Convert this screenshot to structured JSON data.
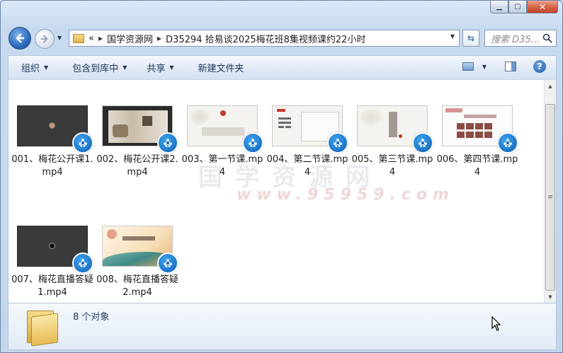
{
  "window": {
    "caption_minimize": "0",
    "caption_maximize": "1",
    "caption_close": "×"
  },
  "address_bar": {
    "chevron": "«",
    "breadcrumbs": [
      "国学资源网",
      "D35294 拾易谈2025梅花班8集视频课约22小时"
    ]
  },
  "search": {
    "placeholder": "搜索 D35..."
  },
  "toolbar": {
    "organize": "组织",
    "include_library": "包含到库中",
    "share": "共享",
    "new_folder": "新建文件夹"
  },
  "watermark": {
    "line1": "国学资源网",
    "line2": "www.95959.com"
  },
  "files": [
    {
      "name": "001、梅花公开课1.mp4"
    },
    {
      "name": "002、梅花公开课2.mp4"
    },
    {
      "name": "003、第一节课.mp4"
    },
    {
      "name": "004、第二节课.mp4"
    },
    {
      "name": "005、第三节课.mp4"
    },
    {
      "name": "006、第四节课.mp4"
    },
    {
      "name": "007、梅花直播答疑1.mp4"
    },
    {
      "name": "008、梅花直播答疑2.mp4"
    }
  ],
  "status": {
    "count": "8 个对象"
  },
  "colors": {
    "accent": "#1e395b",
    "badge": "#0d5fb6",
    "close": "#c5402a"
  }
}
